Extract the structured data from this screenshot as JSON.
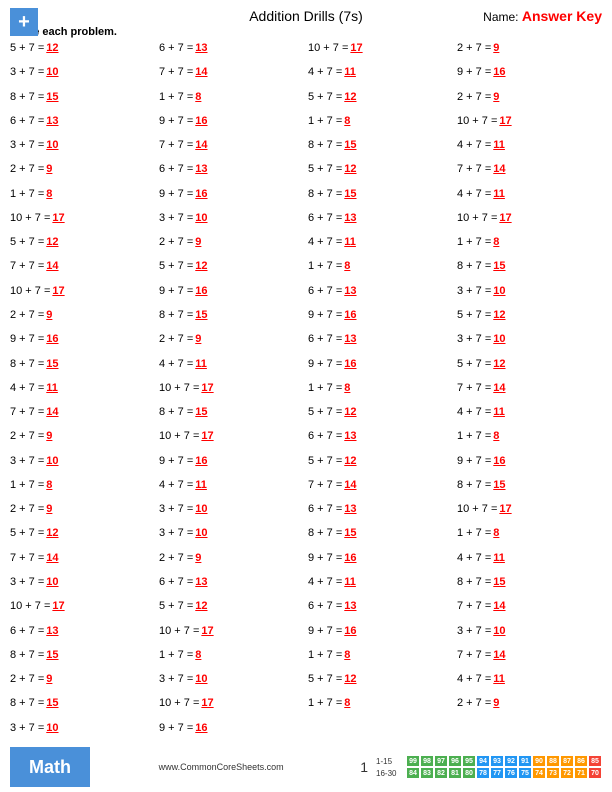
{
  "header": {
    "title": "Addition Drills (7s)",
    "name_label": "Name:",
    "answer_key": "Answer Key"
  },
  "instructions": "Solve each problem.",
  "problems": [
    {
      "eq": "5 + 7 = ",
      "ans": "12"
    },
    {
      "eq": "6 + 7 = ",
      "ans": "13"
    },
    {
      "eq": "10 + 7 = ",
      "ans": "17"
    },
    {
      "eq": "2 + 7 = ",
      "ans": "9"
    },
    {
      "eq": "3 + 7 = ",
      "ans": "10"
    },
    {
      "eq": "7 + 7 = ",
      "ans": "14"
    },
    {
      "eq": "4 + 7 = ",
      "ans": "11"
    },
    {
      "eq": "9 + 7 = ",
      "ans": "16"
    },
    {
      "eq": "8 + 7 = ",
      "ans": "15"
    },
    {
      "eq": "1 + 7 = ",
      "ans": "8"
    },
    {
      "eq": "5 + 7 = ",
      "ans": "12"
    },
    {
      "eq": "2 + 7 = ",
      "ans": "9"
    },
    {
      "eq": "6 + 7 = ",
      "ans": "13"
    },
    {
      "eq": "9 + 7 = ",
      "ans": "16"
    },
    {
      "eq": "1 + 7 = ",
      "ans": "8"
    },
    {
      "eq": "10 + 7 = ",
      "ans": "17"
    },
    {
      "eq": "3 + 7 = ",
      "ans": "10"
    },
    {
      "eq": "7 + 7 = ",
      "ans": "14"
    },
    {
      "eq": "8 + 7 = ",
      "ans": "15"
    },
    {
      "eq": "4 + 7 = ",
      "ans": "11"
    },
    {
      "eq": "2 + 7 = ",
      "ans": "9"
    },
    {
      "eq": "6 + 7 = ",
      "ans": "13"
    },
    {
      "eq": "5 + 7 = ",
      "ans": "12"
    },
    {
      "eq": "7 + 7 = ",
      "ans": "14"
    },
    {
      "eq": "1 + 7 = ",
      "ans": "8"
    },
    {
      "eq": "9 + 7 = ",
      "ans": "16"
    },
    {
      "eq": "8 + 7 = ",
      "ans": "15"
    },
    {
      "eq": "4 + 7 = ",
      "ans": "11"
    },
    {
      "eq": "10 + 7 = ",
      "ans": "17"
    },
    {
      "eq": "3 + 7 = ",
      "ans": "10"
    },
    {
      "eq": "6 + 7 = ",
      "ans": "13"
    },
    {
      "eq": "10 + 7 = ",
      "ans": "17"
    },
    {
      "eq": "5 + 7 = ",
      "ans": "12"
    },
    {
      "eq": "2 + 7 = ",
      "ans": "9"
    },
    {
      "eq": "4 + 7 = ",
      "ans": "11"
    },
    {
      "eq": "1 + 7 = ",
      "ans": "8"
    },
    {
      "eq": "7 + 7 = ",
      "ans": "14"
    },
    {
      "eq": "5 + 7 = ",
      "ans": "12"
    },
    {
      "eq": "1 + 7 = ",
      "ans": "8"
    },
    {
      "eq": "8 + 7 = ",
      "ans": "15"
    },
    {
      "eq": "10 + 7 = ",
      "ans": "17"
    },
    {
      "eq": "9 + 7 = ",
      "ans": "16"
    },
    {
      "eq": "6 + 7 = ",
      "ans": "13"
    },
    {
      "eq": "3 + 7 = ",
      "ans": "10"
    },
    {
      "eq": "2 + 7 = ",
      "ans": "9"
    },
    {
      "eq": "8 + 7 = ",
      "ans": "15"
    },
    {
      "eq": "9 + 7 = ",
      "ans": "16"
    },
    {
      "eq": "5 + 7 = ",
      "ans": "12"
    },
    {
      "eq": "9 + 7 = ",
      "ans": "16"
    },
    {
      "eq": "2 + 7 = ",
      "ans": "9"
    },
    {
      "eq": "6 + 7 = ",
      "ans": "13"
    },
    {
      "eq": "3 + 7 = ",
      "ans": "10"
    },
    {
      "eq": "8 + 7 = ",
      "ans": "15"
    },
    {
      "eq": "4 + 7 = ",
      "ans": "11"
    },
    {
      "eq": "9 + 7 = ",
      "ans": "16"
    },
    {
      "eq": "5 + 7 = ",
      "ans": "12"
    },
    {
      "eq": "4 + 7 = ",
      "ans": "11"
    },
    {
      "eq": "10 + 7 = ",
      "ans": "17"
    },
    {
      "eq": "1 + 7 = ",
      "ans": "8"
    },
    {
      "eq": "7 + 7 = ",
      "ans": "14"
    },
    {
      "eq": "7 + 7 = ",
      "ans": "14"
    },
    {
      "eq": "8 + 7 = ",
      "ans": "15"
    },
    {
      "eq": "5 + 7 = ",
      "ans": "12"
    },
    {
      "eq": "4 + 7 = ",
      "ans": "11"
    },
    {
      "eq": "2 + 7 = ",
      "ans": "9"
    },
    {
      "eq": "10 + 7 = ",
      "ans": "17"
    },
    {
      "eq": "6 + 7 = ",
      "ans": "13"
    },
    {
      "eq": "1 + 7 = ",
      "ans": "8"
    },
    {
      "eq": "3 + 7 = ",
      "ans": "10"
    },
    {
      "eq": "9 + 7 = ",
      "ans": "16"
    },
    {
      "eq": "5 + 7 = ",
      "ans": "12"
    },
    {
      "eq": "9 + 7 = ",
      "ans": "16"
    },
    {
      "eq": "1 + 7 = ",
      "ans": "8"
    },
    {
      "eq": "4 + 7 = ",
      "ans": "11"
    },
    {
      "eq": "7 + 7 = ",
      "ans": "14"
    },
    {
      "eq": "8 + 7 = ",
      "ans": "15"
    },
    {
      "eq": "2 + 7 = ",
      "ans": "9"
    },
    {
      "eq": "3 + 7 = ",
      "ans": "10"
    },
    {
      "eq": "6 + 7 = ",
      "ans": "13"
    },
    {
      "eq": "10 + 7 = ",
      "ans": "17"
    },
    {
      "eq": "5 + 7 = ",
      "ans": "12"
    },
    {
      "eq": "3 + 7 = ",
      "ans": "10"
    },
    {
      "eq": "8 + 7 = ",
      "ans": "15"
    },
    {
      "eq": "1 + 7 = ",
      "ans": "8"
    },
    {
      "eq": "7 + 7 = ",
      "ans": "14"
    },
    {
      "eq": "2 + 7 = ",
      "ans": "9"
    },
    {
      "eq": "9 + 7 = ",
      "ans": "16"
    },
    {
      "eq": "4 + 7 = ",
      "ans": "11"
    },
    {
      "eq": "3 + 7 = ",
      "ans": "10"
    },
    {
      "eq": "6 + 7 = ",
      "ans": "13"
    },
    {
      "eq": "4 + 7 = ",
      "ans": "11"
    },
    {
      "eq": "8 + 7 = ",
      "ans": "15"
    },
    {
      "eq": "10 + 7 = ",
      "ans": "17"
    },
    {
      "eq": "5 + 7 = ",
      "ans": "12"
    },
    {
      "eq": "6 + 7 = ",
      "ans": "13"
    },
    {
      "eq": "7 + 7 = ",
      "ans": "14"
    },
    {
      "eq": "6 + 7 = ",
      "ans": "13"
    },
    {
      "eq": "10 + 7 = ",
      "ans": "17"
    },
    {
      "eq": "9 + 7 = ",
      "ans": "16"
    },
    {
      "eq": "3 + 7 = ",
      "ans": "10"
    },
    {
      "eq": "8 + 7 = ",
      "ans": "15"
    },
    {
      "eq": "1 + 7 = ",
      "ans": "8"
    },
    {
      "eq": "1 + 7 = ",
      "ans": "8"
    },
    {
      "eq": "7 + 7 = ",
      "ans": "14"
    },
    {
      "eq": "2 + 7 = ",
      "ans": "9"
    },
    {
      "eq": "3 + 7 = ",
      "ans": "10"
    },
    {
      "eq": "5 + 7 = ",
      "ans": "12"
    },
    {
      "eq": "4 + 7 = ",
      "ans": "11"
    },
    {
      "eq": "8 + 7 = ",
      "ans": "15"
    },
    {
      "eq": "10 + 7 = ",
      "ans": "17"
    },
    {
      "eq": "1 + 7 = ",
      "ans": "8"
    },
    {
      "eq": "2 + 7 = ",
      "ans": "9"
    },
    {
      "eq": "3 + 7 = ",
      "ans": "10"
    },
    {
      "eq": "9 + 7 = ",
      "ans": "16"
    }
  ],
  "footer": {
    "math_label": "Math",
    "website": "www.CommonCoreSheets.com",
    "page_number": "1",
    "score_rows": [
      {
        "label": "1-15",
        "cells": [
          {
            "val": "99",
            "color": "#4caf50"
          },
          {
            "val": "98",
            "color": "#4caf50"
          },
          {
            "val": "97",
            "color": "#4caf50"
          },
          {
            "val": "96",
            "color": "#4caf50"
          },
          {
            "val": "95",
            "color": "#4caf50"
          },
          {
            "val": "94",
            "color": "#2196f3"
          },
          {
            "val": "93",
            "color": "#2196f3"
          },
          {
            "val": "92",
            "color": "#2196f3"
          },
          {
            "val": "91",
            "color": "#2196f3"
          },
          {
            "val": "90",
            "color": "#ff9800"
          },
          {
            "val": "88",
            "color": "#ff9800"
          },
          {
            "val": "87",
            "color": "#ff9800"
          },
          {
            "val": "86",
            "color": "#ff9800"
          },
          {
            "val": "85",
            "color": "#f44336"
          }
        ]
      },
      {
        "label": "16-30",
        "cells": [
          {
            "val": "84",
            "color": "#4caf50"
          },
          {
            "val": "83",
            "color": "#4caf50"
          },
          {
            "val": "82",
            "color": "#4caf50"
          },
          {
            "val": "81",
            "color": "#4caf50"
          },
          {
            "val": "80",
            "color": "#4caf50"
          },
          {
            "val": "78",
            "color": "#2196f3"
          },
          {
            "val": "77",
            "color": "#2196f3"
          },
          {
            "val": "76",
            "color": "#2196f3"
          },
          {
            "val": "75",
            "color": "#2196f3"
          },
          {
            "val": "74",
            "color": "#ff9800"
          },
          {
            "val": "73",
            "color": "#ff9800"
          },
          {
            "val": "72",
            "color": "#ff9800"
          },
          {
            "val": "71",
            "color": "#ff9800"
          },
          {
            "val": "70",
            "color": "#f44336"
          }
        ]
      }
    ]
  }
}
